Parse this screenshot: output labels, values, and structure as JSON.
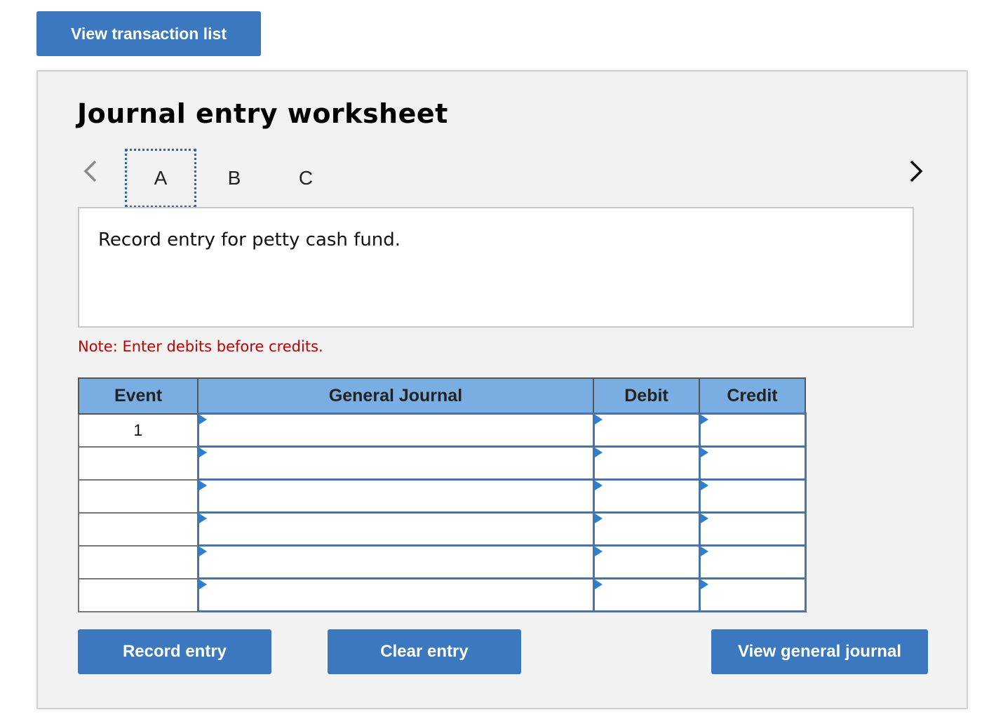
{
  "toolbar": {
    "view_transactions_label": "View transaction list"
  },
  "worksheet": {
    "title": "Journal entry worksheet",
    "tabs": [
      {
        "label": "A"
      },
      {
        "label": "B"
      },
      {
        "label": "C"
      }
    ],
    "active_tab": "A",
    "description": "Record entry for petty cash fund.",
    "note": "Note: Enter debits before credits."
  },
  "table": {
    "headers": {
      "event": "Event",
      "journal": "General Journal",
      "debit": "Debit",
      "credit": "Credit"
    },
    "rows": [
      {
        "event": "1",
        "journal": "",
        "debit": "",
        "credit": ""
      },
      {
        "event": "",
        "journal": "",
        "debit": "",
        "credit": ""
      },
      {
        "event": "",
        "journal": "",
        "debit": "",
        "credit": ""
      },
      {
        "event": "",
        "journal": "",
        "debit": "",
        "credit": ""
      },
      {
        "event": "",
        "journal": "",
        "debit": "",
        "credit": ""
      },
      {
        "event": "",
        "journal": "",
        "debit": "",
        "credit": ""
      }
    ]
  },
  "buttons": {
    "record": "Record entry",
    "clear": "Clear entry",
    "view_journal": "View general journal"
  },
  "colors": {
    "button": "#3b78bf",
    "header": "#7aaee3",
    "note": "#c00000",
    "panel": "#f2f2f2"
  },
  "icons": {
    "prev": "chevron-left-icon",
    "next": "chevron-right-icon",
    "dropdown": "dropdown-triangle-icon"
  }
}
